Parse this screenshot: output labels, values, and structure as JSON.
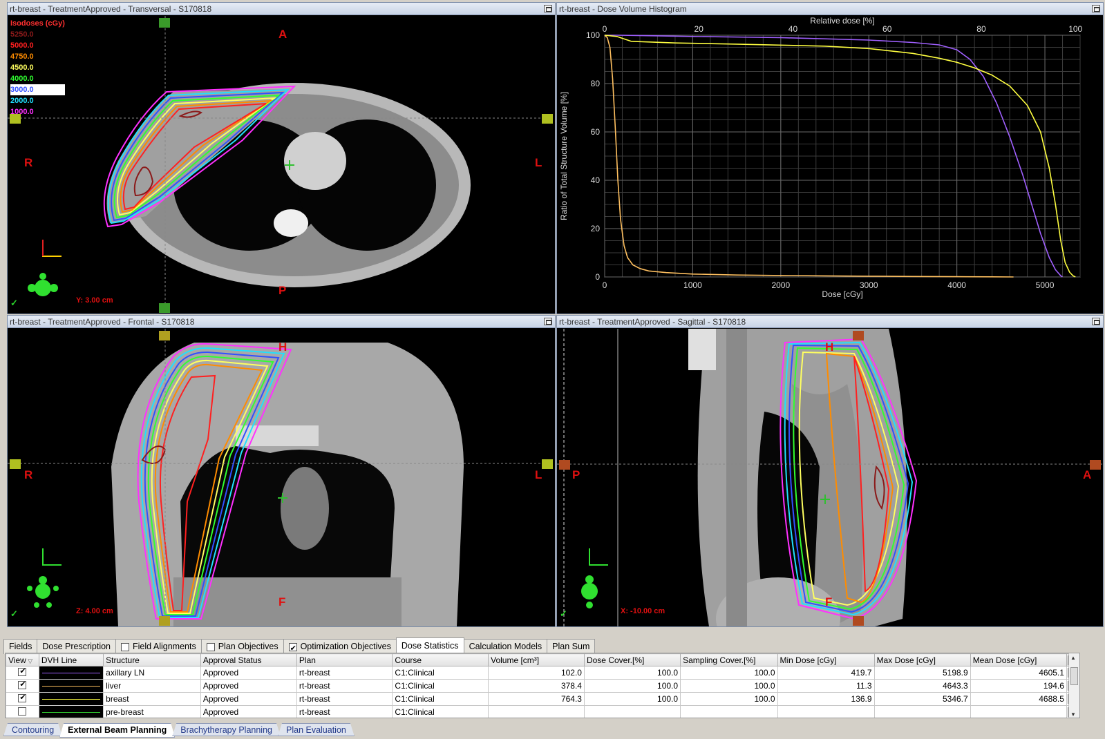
{
  "panes": {
    "transversal": {
      "title": "rt-breast  -  TreatmentApproved - Transversal - S170818",
      "top": "A",
      "bottom": "P",
      "left": "R",
      "right": "L",
      "coord": "Y: 3.00 cm"
    },
    "dvh": {
      "title": "rt-breast - Dose Volume Histogram"
    },
    "frontal": {
      "title": "rt-breast  -  TreatmentApproved - Frontal - S170818",
      "top": "H",
      "bottom": "F",
      "left": "R",
      "right": "L",
      "coord": "Z: 4.00 cm"
    },
    "sagittal": {
      "title": "rt-breast  -  TreatmentApproved - Sagittal - S170818",
      "top": "H",
      "bottom": "F",
      "left": "P",
      "right": "A",
      "coord": "X: -10.00 cm"
    }
  },
  "isodoses": {
    "title": "Isodoses (cGy)",
    "title_color": "#ff3030",
    "levels": [
      {
        "label": "5250.0",
        "color": "#8b1a1a"
      },
      {
        "label": "5000.0",
        "color": "#ff2020"
      },
      {
        "label": "4750.0",
        "color": "#ff8c00"
      },
      {
        "label": "4500.0",
        "color": "#ffff60"
      },
      {
        "label": "4000.0",
        "color": "#30ff30"
      },
      {
        "label": "3000.0",
        "color": "#3050ff"
      },
      {
        "label": "2000.0",
        "color": "#20e0ff"
      },
      {
        "label": "1000.0",
        "color": "#ff30ff"
      }
    ]
  },
  "chart_data": {
    "type": "line",
    "title": "",
    "xlabel": "Dose [cGy]",
    "x2label": "Relative dose [%]",
    "ylabel": "Ratio of Total Structure Volume [%]",
    "xlim": [
      0,
      5400
    ],
    "ylim": [
      0,
      100
    ],
    "xticks": [
      0,
      1000,
      2000,
      3000,
      4000,
      5000
    ],
    "x2ticks": [
      0,
      20,
      40,
      60,
      80,
      100
    ],
    "yticks": [
      0,
      20,
      40,
      60,
      80,
      100
    ],
    "grid": true,
    "series": [
      {
        "color": "#ffc060",
        "x": [
          0,
          30,
          60,
          90,
          120,
          150,
          180,
          220,
          260,
          320,
          400,
          500,
          700,
          1000,
          1500,
          2000,
          2500,
          3000,
          3500,
          4000,
          4400,
          4643
        ],
        "y": [
          100,
          99,
          95,
          82,
          62,
          40,
          24,
          13,
          8,
          5,
          3.5,
          2.5,
          1.8,
          1.2,
          0.8,
          0.6,
          0.45,
          0.3,
          0.2,
          0.1,
          0.05,
          0
        ]
      },
      {
        "color": "#a060ff",
        "x": [
          0,
          150,
          500,
          1000,
          2000,
          3000,
          3500,
          3800,
          4000,
          4150,
          4300,
          4450,
          4600,
          4750,
          4850,
          4950,
          5050,
          5120,
          5180,
          5199
        ],
        "y": [
          100,
          100,
          99.8,
          99.5,
          99,
          98,
          97,
          96,
          94,
          90,
          83,
          72,
          58,
          42,
          30,
          18,
          8,
          3,
          0.5,
          0
        ]
      },
      {
        "color": "#ffff40",
        "x": [
          0,
          137,
          300,
          800,
          1500,
          2500,
          3000,
          3500,
          3800,
          4000,
          4200,
          4400,
          4600,
          4800,
          4950,
          5050,
          5120,
          5180,
          5230,
          5280,
          5320,
          5347
        ],
        "y": [
          100,
          99.5,
          97.5,
          96.8,
          96.3,
          95.5,
          94.5,
          92.5,
          90.5,
          88.8,
          86.5,
          83.5,
          79,
          71,
          60,
          45,
          30,
          15,
          6,
          2,
          0.5,
          0
        ]
      }
    ]
  },
  "tabs": [
    {
      "label": "Fields",
      "checkbox": null
    },
    {
      "label": "Dose Prescription",
      "checkbox": null
    },
    {
      "label": "Field Alignments",
      "checkbox": false
    },
    {
      "label": "Plan Objectives",
      "checkbox": false
    },
    {
      "label": "Optimization Objectives",
      "checkbox": true
    },
    {
      "label": "Dose Statistics",
      "checkbox": null,
      "active": true
    },
    {
      "label": "Calculation Models",
      "checkbox": null
    },
    {
      "label": "Plan Sum",
      "checkbox": null
    }
  ],
  "table": {
    "columns": [
      "View",
      "DVH Line",
      "Structure",
      "Approval Status",
      "Plan",
      "Course",
      "Volume [cm³]",
      "Dose Cover.[%]",
      "Sampling Cover.[%]",
      "Min Dose [cGy]",
      "Max Dose [cGy]",
      "Mean Dose [cGy]"
    ],
    "rows": [
      {
        "checked": true,
        "dvh_color": "#a060ff",
        "cells": [
          "axillary LN",
          "Approved",
          "rt-breast",
          "C1:Clinical",
          "102.0",
          "100.0",
          "100.0",
          "419.7",
          "5198.9",
          "4605.1"
        ]
      },
      {
        "checked": true,
        "dvh_color": "#ffc060",
        "cells": [
          "liver",
          "Approved",
          "rt-breast",
          "C1:Clinical",
          "378.4",
          "100.0",
          "100.0",
          "11.3",
          "4643.3",
          "194.6"
        ]
      },
      {
        "checked": true,
        "dvh_color": "#ffff40",
        "cells": [
          "breast",
          "Approved",
          "rt-breast",
          "C1:Clinical",
          "764.3",
          "100.0",
          "100.0",
          "136.9",
          "5346.7",
          "4688.5"
        ]
      },
      {
        "checked": false,
        "dvh_color": "#30d030",
        "cells": [
          "pre-breast",
          "Approved",
          "rt-breast",
          "C1:Clinical",
          "",
          "",
          "",
          "",
          "",
          ""
        ]
      }
    ]
  },
  "workspaces": [
    {
      "label": "Contouring"
    },
    {
      "label": "External Beam Planning",
      "active": true
    },
    {
      "label": "Brachytherapy Planning"
    },
    {
      "label": "Plan Evaluation"
    }
  ]
}
